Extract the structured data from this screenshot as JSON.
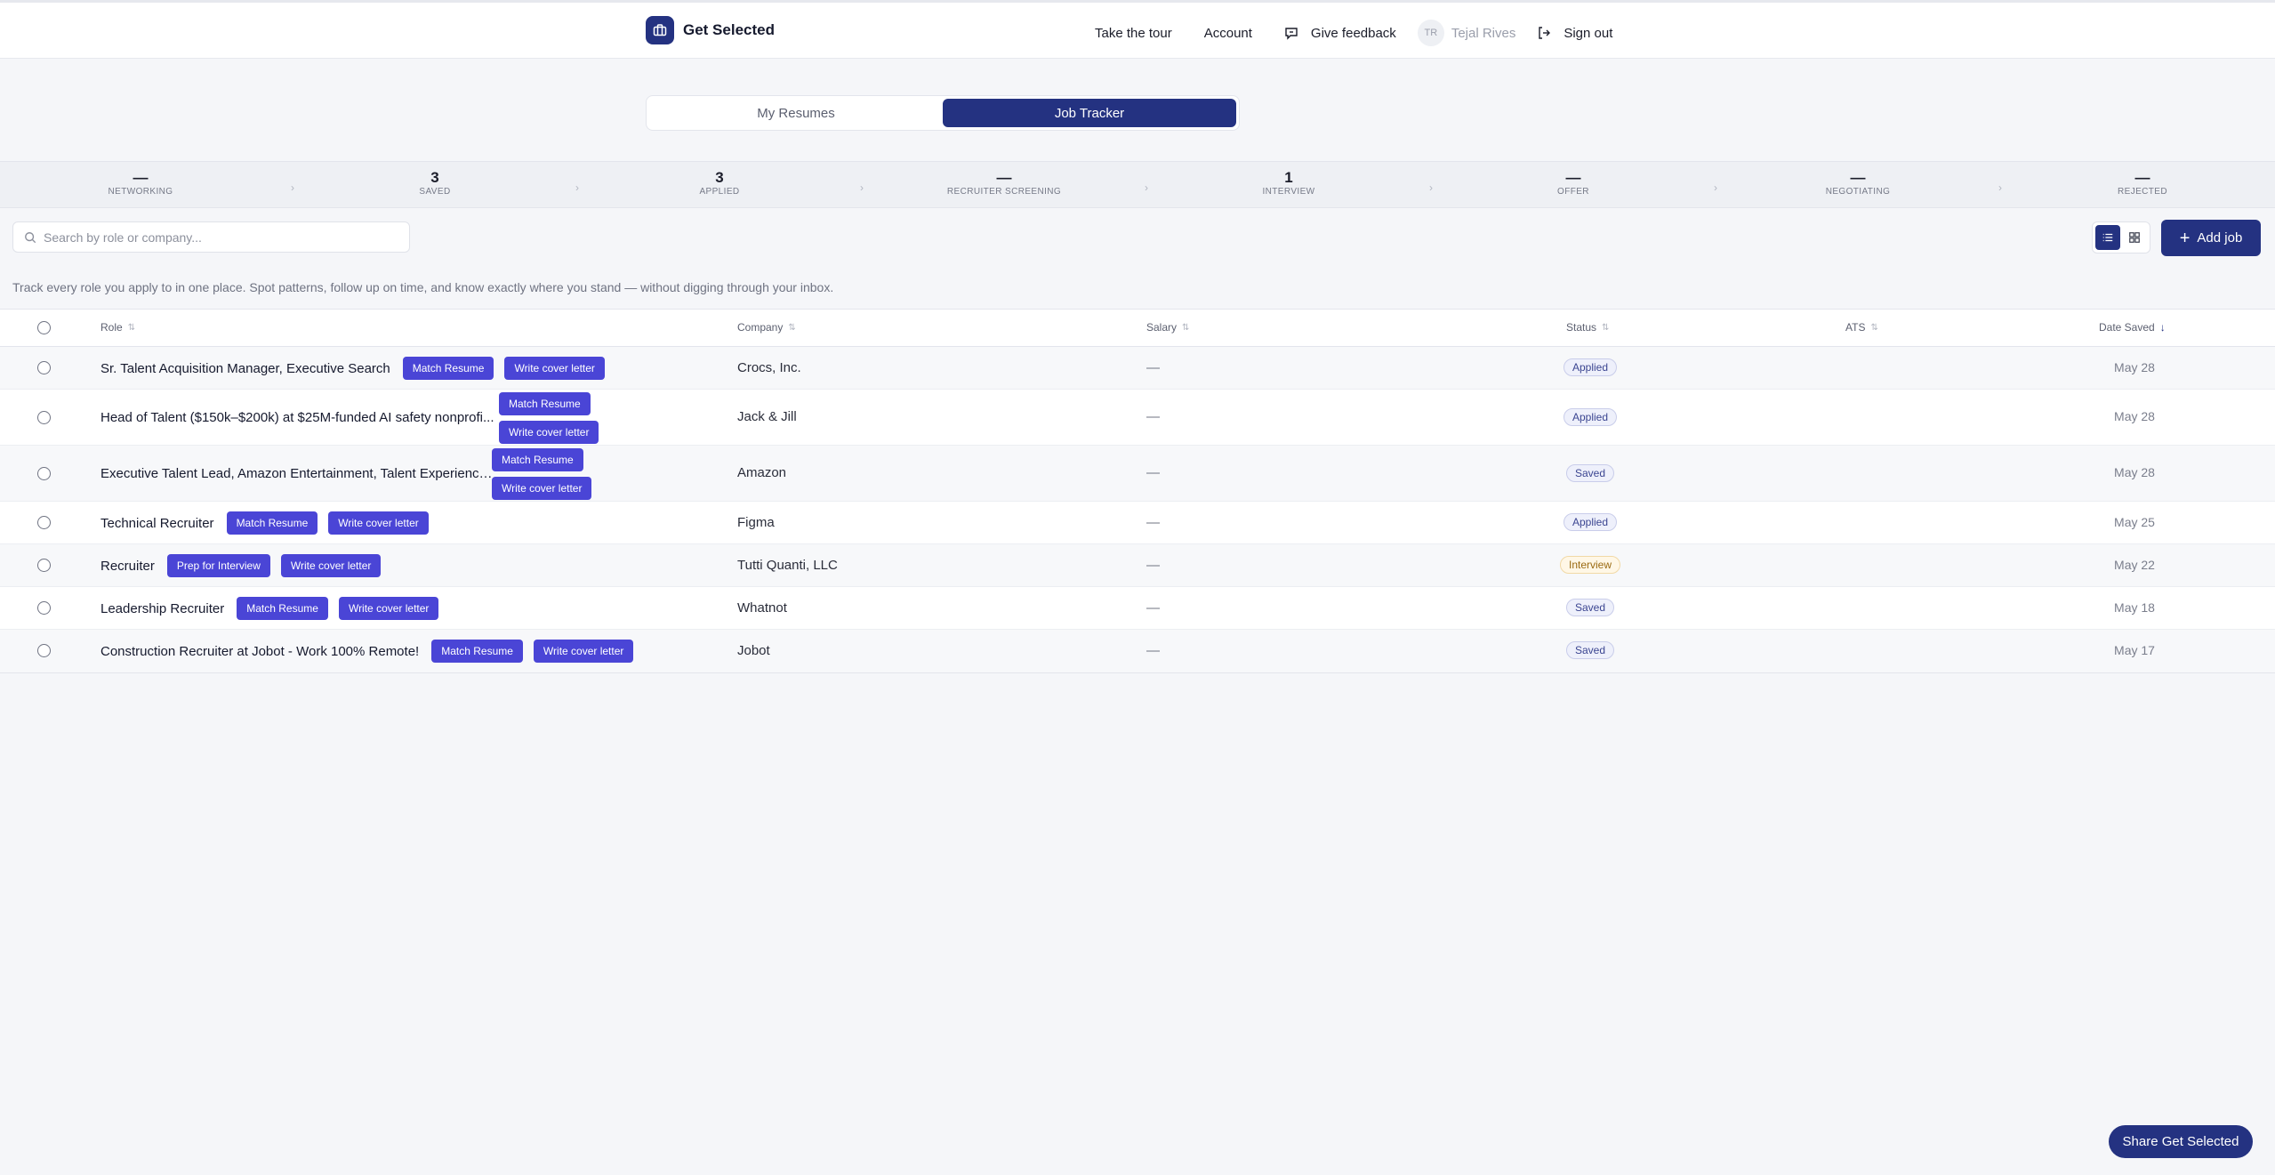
{
  "header": {
    "brand": "Get Selected",
    "nav": {
      "tour": "Take the tour",
      "account": "Account",
      "feedback": "Give feedback",
      "avatar_initials": "TR",
      "user_name": "Tejal Rives",
      "sign_out": "Sign out"
    }
  },
  "tabs": {
    "my_resumes": "My Resumes",
    "job_tracker": "Job Tracker"
  },
  "pipeline": [
    {
      "count": "—",
      "label": "NETWORKING"
    },
    {
      "count": "3",
      "label": "SAVED"
    },
    {
      "count": "3",
      "label": "APPLIED"
    },
    {
      "count": "—",
      "label": "RECRUITER SCREENING"
    },
    {
      "count": "1",
      "label": "INTERVIEW"
    },
    {
      "count": "—",
      "label": "OFFER"
    },
    {
      "count": "—",
      "label": "NEGOTIATING"
    },
    {
      "count": "—",
      "label": "REJECTED"
    }
  ],
  "search": {
    "placeholder": "Search by role or company...",
    "value": ""
  },
  "toolbar": {
    "add_job": "Add job"
  },
  "tagline": "Track every role you apply to in one place. Spot patterns, follow up on time, and know exactly where you stand — without digging through your inbox.",
  "columns": {
    "role": "Role",
    "company": "Company",
    "salary": "Salary",
    "status": "Status",
    "ats": "ATS",
    "date_saved": "Date Saved"
  },
  "rows": [
    {
      "role": "Sr. Talent Acquisition Manager, Executive Search",
      "btn1": "Match Resume",
      "btn2": "Write cover letter",
      "company": "Crocs, Inc.",
      "salary": "—",
      "status": "Applied",
      "date": "May 28"
    },
    {
      "role": "Head of Talent ($150k–$200k) at $25M-funded AI safety nonprofi...",
      "btn1": "Match Resume",
      "btn2": "Write cover letter",
      "company": "Jack & Jill",
      "salary": "—",
      "status": "Applied",
      "date": "May 28"
    },
    {
      "role": "Executive Talent Lead, Amazon Entertainment, Talent Experience ...",
      "btn1": "Match Resume",
      "btn2": "Write cover letter",
      "company": "Amazon",
      "salary": "—",
      "status": "Saved",
      "date": "May 28"
    },
    {
      "role": "Technical Recruiter",
      "btn1": "Match Resume",
      "btn2": "Write cover letter",
      "company": "Figma",
      "salary": "—",
      "status": "Applied",
      "date": "May 25"
    },
    {
      "role": "Recruiter",
      "btn1": "Prep for Interview",
      "btn2": "Write cover letter",
      "company": "Tutti Quanti, LLC",
      "salary": "—",
      "status": "Interview",
      "date": "May 22"
    },
    {
      "role": "Leadership Recruiter",
      "btn1": "Match Resume",
      "btn2": "Write cover letter",
      "company": "Whatnot",
      "salary": "—",
      "status": "Saved",
      "date": "May 18"
    },
    {
      "role": "Construction Recruiter at Jobot - Work 100% Remote!",
      "btn1": "Match Resume",
      "btn2": "Write cover letter",
      "company": "Jobot",
      "salary": "—",
      "status": "Saved",
      "date": "May 17"
    }
  ],
  "share_button": "Share Get Selected",
  "colors": {
    "primary": "#243281",
    "action": "#4a45d6",
    "interview": "#9a6a12"
  }
}
